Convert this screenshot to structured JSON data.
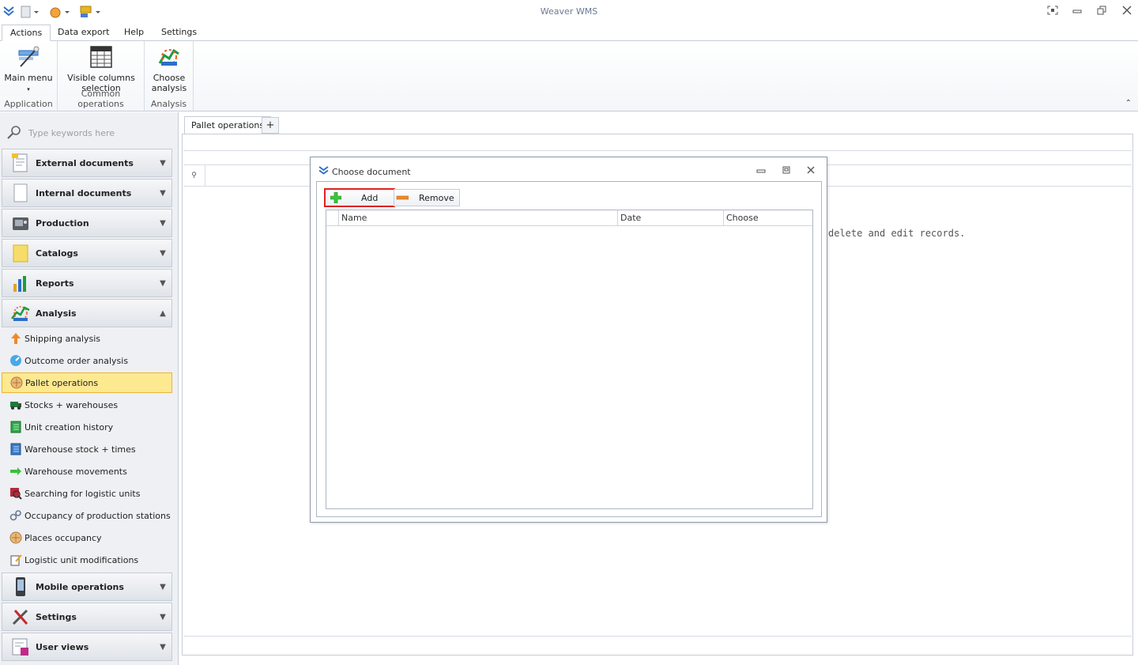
{
  "window": {
    "title": "Weaver WMS"
  },
  "ribbon": {
    "tabs": [
      "Actions",
      "Data export",
      "Help",
      "Settings"
    ],
    "groups": [
      {
        "label": "Application",
        "buttons": [
          {
            "label_line1": "Main menu",
            "label_line2": "▾"
          }
        ]
      },
      {
        "label": "Common operations",
        "buttons": [
          {
            "label_line1": "Visible columns",
            "label_line2": "selection"
          }
        ]
      },
      {
        "label": "Analysis",
        "buttons": [
          {
            "label_line1": "Choose",
            "label_line2": "analysis"
          }
        ]
      }
    ]
  },
  "sidebar": {
    "search_placeholder": "Type keywords here",
    "headers_top": [
      {
        "label": "External documents",
        "icon": "document-icon"
      },
      {
        "label": "Internal documents",
        "icon": "blank-page-icon"
      },
      {
        "label": "Production",
        "icon": "machine-icon"
      },
      {
        "label": "Catalogs",
        "icon": "folder-icon"
      },
      {
        "label": "Reports",
        "icon": "bar-chart-icon"
      },
      {
        "label": "Analysis",
        "icon": "analysis-icon",
        "expanded": true
      }
    ],
    "analysis_items": [
      {
        "label": "Shipping analysis",
        "icon": "arrow-up-icon"
      },
      {
        "label": "Outcome order analysis",
        "icon": "gauge-icon"
      },
      {
        "label": "Pallet operations",
        "icon": "pallet-icon",
        "selected": true
      },
      {
        "label": "Stocks + warehouses",
        "icon": "truck-icon"
      },
      {
        "label": "Unit creation history",
        "icon": "green-book-icon"
      },
      {
        "label": "Warehouse stock + times",
        "icon": "blue-book-icon"
      },
      {
        "label": "Warehouse movements",
        "icon": "green-arrows-icon"
      },
      {
        "label": "Searching for logistic units",
        "icon": "search-box-icon"
      },
      {
        "label": "Occupancy of production stations",
        "icon": "gears-icon"
      },
      {
        "label": "Places occupancy",
        "icon": "pallet-icon"
      },
      {
        "label": "Logistic unit modifications",
        "icon": "edit-icon"
      }
    ],
    "headers_bottom": [
      {
        "label": "Mobile operations",
        "icon": "mobile-icon"
      },
      {
        "label": "Settings",
        "icon": "tools-icon"
      },
      {
        "label": "User views",
        "icon": "user-views-icon"
      }
    ]
  },
  "main": {
    "tab_label": "Pallet operations",
    "tab_add": "+",
    "filter_symbol": "⚲",
    "empty_message": "delete and edit records."
  },
  "dialog": {
    "title": "Choose document",
    "add_label": "Add",
    "remove_label": "Remove",
    "columns": [
      "Name",
      "Date",
      "Choose"
    ]
  },
  "colors": {
    "selection_bg": "#fde990",
    "selection_border": "#e9b53a",
    "highlight_red": "#e02020",
    "title_text": "#6a7a94"
  }
}
